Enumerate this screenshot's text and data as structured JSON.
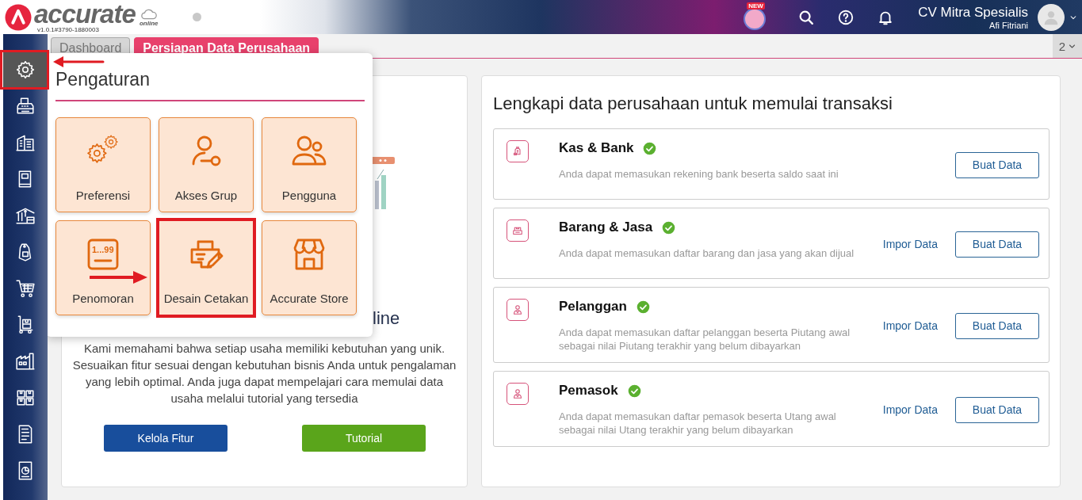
{
  "header": {
    "logo": "accurate",
    "logo_sub": "online",
    "version": "v1.0.1#3790-1880003",
    "badge": "NEW",
    "company": "CV Mitra Spesialis",
    "user": "Afi Fitriani"
  },
  "tabs": [
    {
      "label": "Dashboard",
      "selected": false
    },
    {
      "label": "Persiapan Data Perusahaan",
      "selected": true
    }
  ],
  "tab_counter": "2",
  "sidebar": {
    "items": [
      {
        "kind": "settings",
        "selected": true,
        "highlighted": true
      },
      {
        "kind": "fax",
        "selected": false,
        "highlighted": false
      },
      {
        "kind": "building",
        "selected": false,
        "highlighted": false
      },
      {
        "kind": "book",
        "selected": false,
        "highlighted": false
      },
      {
        "kind": "bank",
        "selected": false,
        "highlighted": false
      },
      {
        "kind": "tag",
        "selected": false,
        "highlighted": false
      },
      {
        "kind": "cart",
        "selected": false,
        "highlighted": false
      },
      {
        "kind": "trolley",
        "selected": false,
        "highlighted": false
      },
      {
        "kind": "warehouse",
        "selected": false,
        "highlighted": false
      },
      {
        "kind": "boxes",
        "selected": false,
        "highlighted": false
      },
      {
        "kind": "tax",
        "selected": false,
        "highlighted": false
      },
      {
        "kind": "report",
        "selected": false,
        "highlighted": false
      }
    ]
  },
  "settings_menu": {
    "title": "Pengaturan",
    "tiles": [
      {
        "label": "Preferensi",
        "kind": "gears",
        "highlighted": false
      },
      {
        "label": "Akses Grup",
        "kind": "user-key",
        "highlighted": false
      },
      {
        "label": "Pengguna",
        "kind": "users",
        "highlighted": false
      },
      {
        "label": "Penomoran",
        "kind": "numbering",
        "icon_text": "1...99",
        "highlighted": false
      },
      {
        "label": "Desain Cetakan",
        "kind": "print-design",
        "highlighted": true
      },
      {
        "label": "Accurate Store",
        "kind": "store",
        "highlighted": false
      }
    ]
  },
  "intro": {
    "heading": "line",
    "text": "Kami memahami bahwa setiap usaha memiliki kebutuhan yang unik. Sesuaikan fitur sesuai dengan kebutuhan bisnis Anda untuk pengalaman yang lebih optimal. Anda juga dapat mempelajari cara memulai data usaha melalui tutorial yang tersedia",
    "buttons": [
      {
        "label": "Kelola Fitur",
        "kind": "primary"
      },
      {
        "label": "Tutorial",
        "kind": "success"
      }
    ]
  },
  "checklist": {
    "title": "Lengkapi data perusahaan untuk memulai transaksi",
    "items": [
      {
        "title": "Kas & Bank",
        "kind": "money",
        "completed": true,
        "description": "Anda dapat memasukan rekening bank beserta saldo saat ini",
        "create_label": "Buat Data"
      },
      {
        "title": "Barang & Jasa",
        "kind": "goods",
        "completed": true,
        "description": "Anda dapat memasukan daftar barang dan jasa yang akan dijual",
        "import_label": "Impor Data",
        "create_label": "Buat Data"
      },
      {
        "title": "Pelanggan",
        "kind": "person",
        "completed": true,
        "description": "Anda dapat memasukan daftar pelanggan beserta Piutang awal sebagai nilai Piutang terakhir yang belum dibayarkan",
        "import_label": "Impor Data",
        "create_label": "Buat Data"
      },
      {
        "title": "Pemasok",
        "kind": "person",
        "completed": true,
        "description": "Anda dapat memasukan daftar pemasok beserta Utang awal sebagai nilai Utang terakhir yang belum dibayarkan",
        "import_label": "Impor Data",
        "create_label": "Buat Data"
      }
    ]
  }
}
